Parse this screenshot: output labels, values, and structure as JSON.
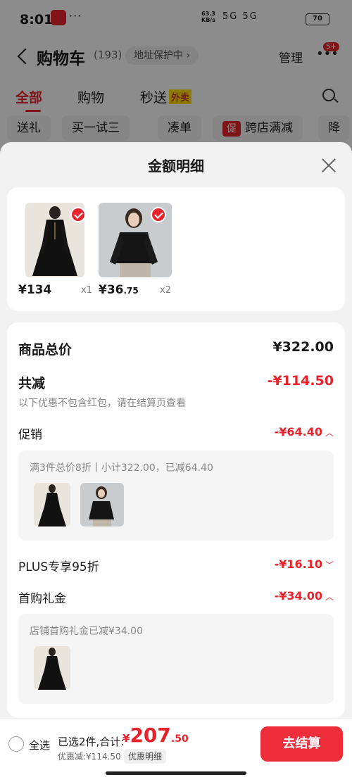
{
  "status": {
    "time": "8:01",
    "dots": "···",
    "net_speed": "63.3",
    "net_unit": "KB/s",
    "signal": "5G 5G",
    "battery": "70"
  },
  "nav": {
    "title": "购物车",
    "count": "(193)",
    "address": "地址保护中 ›",
    "manage": "管理",
    "more": "•••",
    "badge": "5+"
  },
  "tabs": [
    {
      "label": "全部"
    },
    {
      "label": "购物"
    },
    {
      "label": "秒送",
      "tag": "外卖"
    }
  ],
  "chips": [
    {
      "label": "送礼"
    },
    {
      "label": "买一试三"
    },
    {
      "label": "凑单"
    },
    {
      "label": "跨店满减",
      "icon": "促"
    },
    {
      "label": "降"
    }
  ],
  "sheet": {
    "title": "金额明细",
    "products": [
      {
        "price": "¥134",
        "qty": "x1"
      },
      {
        "price_int": "¥36",
        "price_dec": ".75",
        "qty": "x2"
      }
    ],
    "total_label": "商品总价",
    "total_value": "¥322.00",
    "reduce_label": "共减",
    "reduce_value": "-¥114.50",
    "reduce_note": "以下优惠不包含红包，请在结算页查看",
    "promo_label": "促销",
    "promo_value": "-¥64.40",
    "promo_detail": "满3件总价8折丨小计322.00，已减64.40",
    "plus_label": "PLUS专享95折",
    "plus_value": "-¥16.10",
    "gift_label": "首购礼金",
    "gift_value": "-¥34.00",
    "gift_detail": "店铺首购礼金已减¥34.00"
  },
  "footer": {
    "select_all": "全选",
    "selected": "已选2件,合计:",
    "currency": "¥",
    "amount_int": "207",
    "amount_dec": ".50",
    "saved": "优惠减:¥114.50",
    "detail_btn": "优惠明细",
    "checkout": "去结算"
  },
  "colors": {
    "accent": "#e8232c",
    "checkout": "#ee2d3b"
  }
}
